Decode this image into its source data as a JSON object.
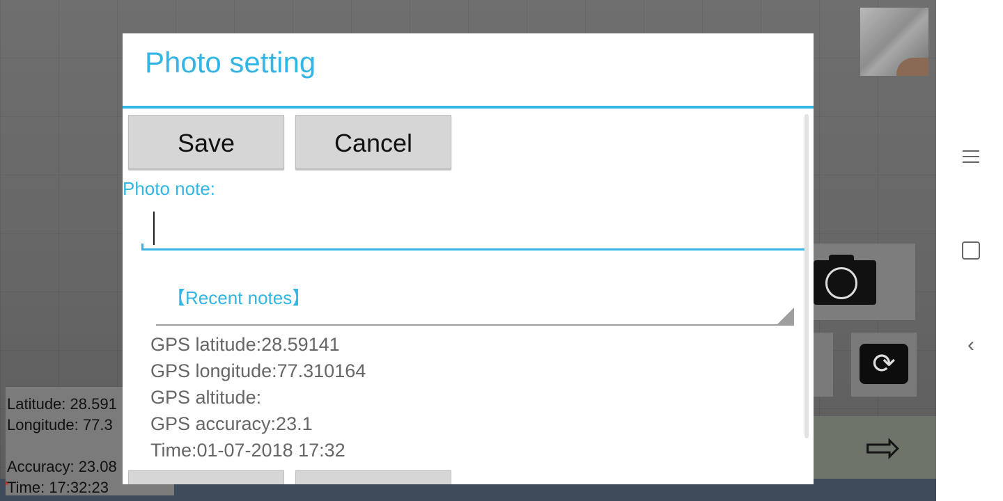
{
  "dialog": {
    "title": "Photo setting",
    "save_label": "Save",
    "cancel_label": "Cancel",
    "note_label": "Photo note:",
    "note_value": "",
    "recent_notes": "【Recent notes】",
    "gps": {
      "latitude": "GPS latitude:28.59141",
      "longitude": "GPS longitude:77.310164",
      "altitude": "GPS altitude:",
      "accuracy": "GPS accuracy:23.1",
      "time": "Time:01-07-2018 17:32"
    }
  },
  "overlay_info": {
    "latitude": "Latitude: 28.591",
    "longitude": "Longitude: 77.3",
    "accuracy": "Accuracy: 23.08",
    "time": "Time: 17:32:23"
  },
  "icons": {
    "menu": "menu-icon",
    "home": "square-icon",
    "back": "chevron-left-icon",
    "shutter": "camera-icon",
    "switch": "camera-switch-icon",
    "exit": "exit-icon"
  },
  "colors": {
    "accent": "#33b5e5",
    "button": "#d6d6d6",
    "secondary_text": "#666666"
  }
}
